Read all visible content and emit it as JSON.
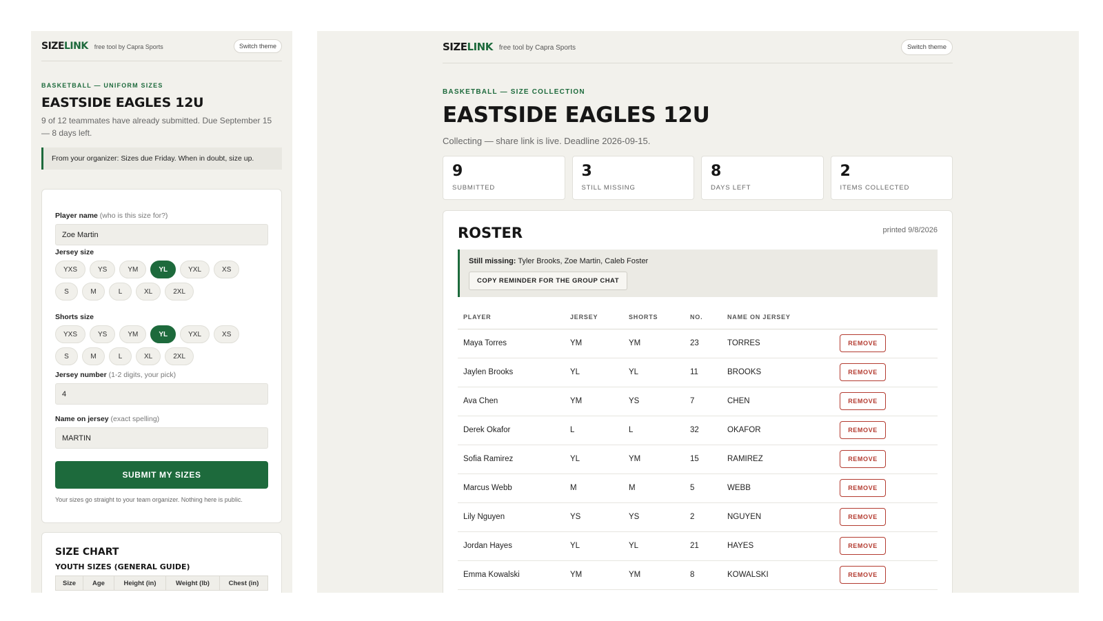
{
  "brand": {
    "name_main": "SIZE",
    "name_accent": "LINK",
    "byline": "free tool by Capra Sports",
    "theme_button": "Switch theme"
  },
  "colors": {
    "accent": "#1d6a3c",
    "danger": "#b33a2f",
    "background": "#f2f1ec"
  },
  "player_view": {
    "eyebrow": "BASKETBALL — UNIFORM SIZES",
    "team": "EASTSIDE EAGLES 12U",
    "intro": "9 of 12 teammates have already submitted. Due September 15 — 8 days left.",
    "organizer_note": "From your organizer: Sizes due Friday. When in doubt, size up.",
    "form": {
      "player_name": {
        "label": "Player name",
        "hint": "(who is this size for?)",
        "value": "Zoe Martin"
      },
      "jersey_size": {
        "label": "Jersey size",
        "options": [
          "YXS",
          "YS",
          "YM",
          "YL",
          "YXL",
          "XS",
          "S",
          "M",
          "L",
          "XL",
          "2XL"
        ],
        "selected": "YL"
      },
      "shorts_size": {
        "label": "Shorts size",
        "options": [
          "YXS",
          "YS",
          "YM",
          "YL",
          "YXL",
          "XS",
          "S",
          "M",
          "L",
          "XL",
          "2XL"
        ],
        "selected": "YL"
      },
      "jersey_number": {
        "label": "Jersey number",
        "hint": "(1-2 digits, your pick)",
        "value": "4"
      },
      "name_on_jersey": {
        "label": "Name on jersey",
        "hint": "(exact spelling)",
        "value": "MARTIN"
      },
      "submit_label": "SUBMIT MY SIZES",
      "footnote": "Your sizes go straight to your team organizer. Nothing here is public."
    },
    "size_chart": {
      "title": "SIZE CHART",
      "subtitle": "YOUTH SIZES (GENERAL GUIDE)",
      "columns": [
        "Size",
        "Age",
        "Height (in)",
        "Weight (lb)",
        "Chest (in)"
      ]
    }
  },
  "organizer_view": {
    "eyebrow": "BASKETBALL — SIZE COLLECTION",
    "team": "EASTSIDE EAGLES 12U",
    "status": "Collecting — share link is live. Deadline 2026-09-15.",
    "stats": [
      {
        "value": "9",
        "label": "SUBMITTED"
      },
      {
        "value": "3",
        "label": "STILL MISSING"
      },
      {
        "value": "8",
        "label": "DAYS LEFT"
      },
      {
        "value": "2",
        "label": "ITEMS COLLECTED"
      }
    ],
    "roster": {
      "title": "ROSTER",
      "printed": "printed 9/8/2026",
      "missing_label": "Still missing:",
      "missing_names": "Tyler Brooks, Zoe Martin, Caleb Foster",
      "copy_button": "COPY REMINDER FOR THE GROUP CHAT",
      "columns": [
        "PLAYER",
        "JERSEY",
        "SHORTS",
        "NO.",
        "NAME ON JERSEY"
      ],
      "remove_label": "REMOVE",
      "rows": [
        {
          "player": "Maya Torres",
          "jersey": "YM",
          "shorts": "YM",
          "no": "23",
          "name": "TORRES"
        },
        {
          "player": "Jaylen Brooks",
          "jersey": "YL",
          "shorts": "YL",
          "no": "11",
          "name": "BROOKS"
        },
        {
          "player": "Ava Chen",
          "jersey": "YM",
          "shorts": "YS",
          "no": "7",
          "name": "CHEN"
        },
        {
          "player": "Derek Okafor",
          "jersey": "L",
          "shorts": "L",
          "no": "32",
          "name": "OKAFOR"
        },
        {
          "player": "Sofia Ramirez",
          "jersey": "YL",
          "shorts": "YM",
          "no": "15",
          "name": "RAMIREZ"
        },
        {
          "player": "Marcus Webb",
          "jersey": "M",
          "shorts": "M",
          "no": "5",
          "name": "WEBB"
        },
        {
          "player": "Lily Nguyen",
          "jersey": "YS",
          "shorts": "YS",
          "no": "2",
          "name": "NGUYEN"
        },
        {
          "player": "Jordan Hayes",
          "jersey": "YL",
          "shorts": "YL",
          "no": "21",
          "name": "HAYES"
        },
        {
          "player": "Emma Kowalski",
          "jersey": "YM",
          "shorts": "YM",
          "no": "8",
          "name": "KOWALSKI"
        }
      ]
    }
  }
}
